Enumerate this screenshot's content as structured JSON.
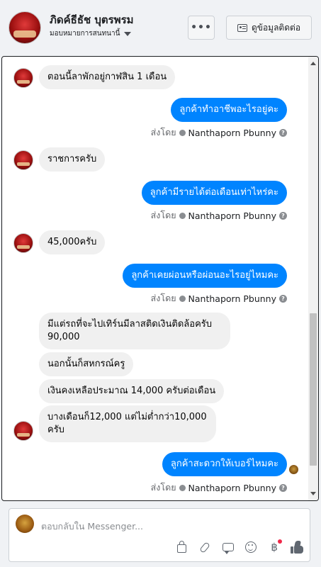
{
  "header": {
    "name": "ภิดค์ธีธัช บุตรพรม",
    "subtitle": "มอบหมายการสนทนานี้",
    "more_label": "•••",
    "contact_label": "ดูข้อมูลติดต่อ"
  },
  "messages": [
    {
      "dir": "in",
      "text": "ตอนนี้ลาพักอยู่กาฬสิน 1 เดือน"
    },
    {
      "dir": "out",
      "text": "ลูกค้าทำอาชีพอะไรอยู่คะ"
    },
    {
      "dir": "in",
      "text": "ราชการครับ"
    },
    {
      "dir": "out",
      "text": "ลูกค้ามีรายได้ต่อเดือนเท่าไหร่คะ"
    },
    {
      "dir": "in",
      "text": "45,000ครับ"
    },
    {
      "dir": "out",
      "text": "ลูกค้าเคยผ่อนหรือผ่อนอะไรอยู่ไหมคะ"
    },
    {
      "dir": "in",
      "text": "มีแต่รถที่จะไปเทิร์นมีลาสติดเงินติดล้อครับ 90,000"
    },
    {
      "dir": "in",
      "text": "นอกนั้นก็สหกรณ์ครู"
    },
    {
      "dir": "in",
      "text": "เงินคงเหลือประมาณ 14,000 ครับต่อเดือน"
    },
    {
      "dir": "in",
      "text": "บางเดือนก็12,000 แต่ไม่ต่ำกว่า10,000 ครับ"
    },
    {
      "dir": "out",
      "text": "ลูกค้าสะดวกให้เบอร์ไหมคะ"
    }
  ],
  "sent_by": {
    "prefix": "ส่งโดย",
    "name": "Nanthaporn Pbunny",
    "help": "?"
  },
  "composer": {
    "placeholder": "ตอบกลับใน Messenger...",
    "baht_symbol": "฿"
  },
  "icons": {
    "more": "more-dots-icon",
    "contact": "contact-card-icon",
    "verified": "verified-check-icon",
    "help": "help-icon",
    "shop": "shopping-bag-icon",
    "attach": "paperclip-icon",
    "saved_reply": "speech-bubble-icon",
    "emoji": "smiley-icon",
    "payment": "baht-icon",
    "like": "thumbs-up-icon"
  },
  "colors": {
    "outgoing_bubble": "#0084ff",
    "incoming_bubble": "#f0f0f0",
    "notification_dot": "#f02849"
  }
}
